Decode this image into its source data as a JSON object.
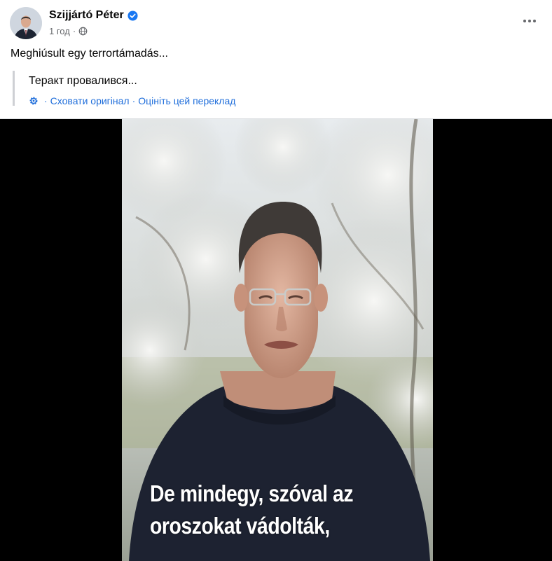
{
  "post": {
    "author": "Szijjártó Péter",
    "timestamp": "1 год",
    "text": "Meghiúsult egy terrortámadás...",
    "translation": {
      "text": "Теракт провалився...",
      "hide_original": "Сховати оригінал",
      "separator": "·",
      "rate_translation": "Оцініть цей переклад"
    },
    "video": {
      "caption_line1": "De mindegy, szóval az",
      "caption_line2": "oroszokat vádolták,"
    }
  },
  "icons": {
    "verified": "verified-badge-icon",
    "privacy": "globe-icon",
    "more": "more-options-icon",
    "translate": "gear-icon"
  },
  "colors": {
    "link": "#216fdb",
    "secondary_text": "#65676b",
    "verified": "#1877f2"
  }
}
